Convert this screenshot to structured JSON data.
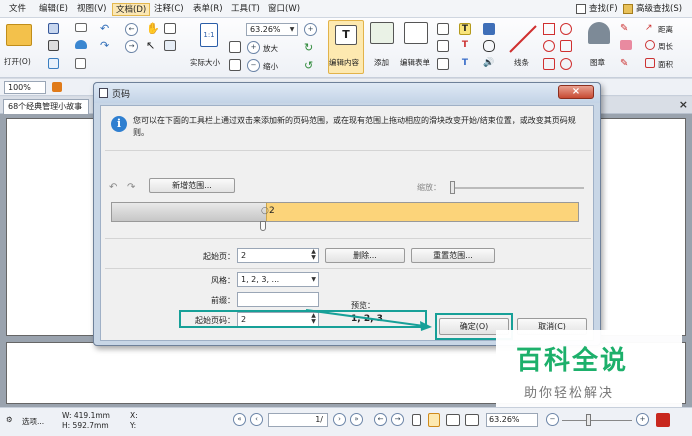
{
  "menu": {
    "items": [
      "文件",
      "编辑(E)",
      "视图(V)",
      "文档(D)",
      "注释(C)",
      "表单(R)",
      "工具(T)",
      "窗口(W)"
    ],
    "active_index": 3,
    "find": "查找(F)",
    "advanced_find": "高级查找(S)"
  },
  "ribbon": {
    "open_label": "打开(O)",
    "zoom_value": "63.26%",
    "actual_size": "实际大小",
    "zoom_in": "放大",
    "zoom_out": "缩小",
    "edit_content": "编辑内容",
    "add": "添加",
    "edit_form": "编辑表单",
    "line": "线条",
    "stamp": "图章",
    "distance": "距离",
    "perimeter": "周长",
    "area": "面积"
  },
  "row2": {
    "zoom": "100%"
  },
  "doc_tab": {
    "title": "68个经典管理小故事"
  },
  "dialog": {
    "title": "页码",
    "info": "您可以在下面的工具栏上通过双击来添加新的页码范围，或在现有范围上拖动相应的滑块改变开始/结束位置，或改变其页码规则。",
    "new_range_btn": "新增范围...",
    "scale_label": "缩放：",
    "range_label": "2",
    "start_page_label": "起始页：",
    "start_page_value": "2",
    "delete_btn": "删除...",
    "reset_btn": "重置范围...",
    "style_label": "风格：",
    "style_value": "1, 2, 3, ...",
    "prefix_label": "前缀：",
    "prefix_value": "",
    "preview_label": "预览：",
    "start_number_label": "起始页码：",
    "start_number_value": "2",
    "preview_value": "1, 2, 3",
    "ok_btn": "确定(O)",
    "cancel_btn": "取消(C)"
  },
  "watermark": {
    "main": "百科全说",
    "sub": "助你轻松解决"
  },
  "statusbar": {
    "options": "选项...",
    "width": "W: 419.1mm",
    "height": "H: 592.7mm",
    "x": "X:",
    "y": "Y:",
    "page": "1/",
    "zoom": "63.26%"
  },
  "colors": {
    "accent": "#17a098",
    "selected": "#fde9b0",
    "range": "#fcd47a"
  }
}
